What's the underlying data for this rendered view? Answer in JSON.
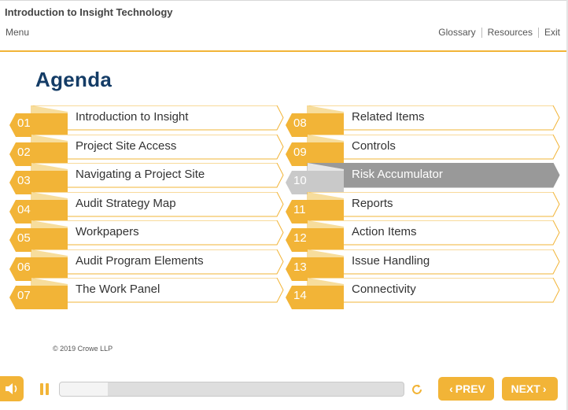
{
  "header": {
    "course_title": "Introduction to Insight Technology",
    "menu_label": "Menu",
    "links": [
      "Glossary",
      "Resources",
      "Exit"
    ]
  },
  "page": {
    "title": "Agenda",
    "copyright": "© 2019 Crowe LLP"
  },
  "agenda": {
    "left": [
      {
        "num": "01",
        "label": "Introduction to Insight"
      },
      {
        "num": "02",
        "label": "Project Site Access"
      },
      {
        "num": "03",
        "label": "Navigating a Project Site"
      },
      {
        "num": "04",
        "label": "Audit Strategy Map"
      },
      {
        "num": "05",
        "label": "Workpapers"
      },
      {
        "num": "06",
        "label": "Audit Program Elements"
      },
      {
        "num": "07",
        "label": "The Work Panel"
      }
    ],
    "right": [
      {
        "num": "08",
        "label": "Related Items"
      },
      {
        "num": "09",
        "label": "Controls"
      },
      {
        "num": "10",
        "label": "Risk Accumulator"
      },
      {
        "num": "11",
        "label": "Reports"
      },
      {
        "num": "12",
        "label": "Action Items"
      },
      {
        "num": "13",
        "label": "Issue Handling"
      },
      {
        "num": "14",
        "label": "Connectivity"
      }
    ],
    "active_num": "10"
  },
  "player": {
    "progress_fraction": 0.14,
    "prev_label": "PREV",
    "next_label": "NEXT"
  },
  "colors": {
    "accent": "#f2b437",
    "accent_dark": "#e2a21f",
    "title": "#143c66",
    "active_tab": "#999999",
    "active_num": "#c9c9c9"
  }
}
